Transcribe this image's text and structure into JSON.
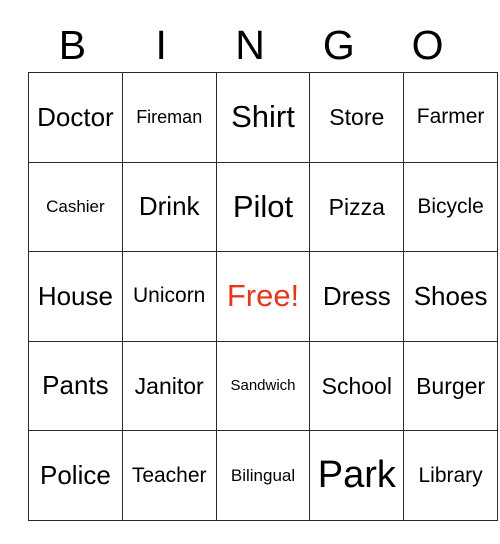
{
  "card": {
    "header_letters": [
      "B",
      "I",
      "N",
      "G",
      "O"
    ],
    "free_color": "#e8361b",
    "text_color": "#000000",
    "border_color": "#2b2b2b",
    "background": "#ffffff",
    "rows": [
      [
        {
          "label": "Doctor",
          "size": "fs-l"
        },
        {
          "label": "Fireman",
          "size": "fs-sm"
        },
        {
          "label": "Shirt",
          "size": "fs-xl"
        },
        {
          "label": "Store",
          "size": "fs-ml"
        },
        {
          "label": "Farmer",
          "size": "fs-m"
        }
      ],
      [
        {
          "label": "Cashier",
          "size": "fs-s"
        },
        {
          "label": "Drink",
          "size": "fs-l"
        },
        {
          "label": "Pilot",
          "size": "fs-xl"
        },
        {
          "label": "Pizza",
          "size": "fs-ml"
        },
        {
          "label": "Bicycle",
          "size": "fs-m"
        }
      ],
      [
        {
          "label": "House",
          "size": "fs-l"
        },
        {
          "label": "Unicorn",
          "size": "fs-m"
        },
        {
          "label": "Free!",
          "size": "free-cell",
          "free": true
        },
        {
          "label": "Dress",
          "size": "fs-l"
        },
        {
          "label": "Shoes",
          "size": "fs-l"
        }
      ],
      [
        {
          "label": "Pants",
          "size": "fs-l"
        },
        {
          "label": "Janitor",
          "size": "fs-ml"
        },
        {
          "label": "Sandwich",
          "size": "fs-xs"
        },
        {
          "label": "School",
          "size": "fs-ml"
        },
        {
          "label": "Burger",
          "size": "fs-ml"
        }
      ],
      [
        {
          "label": "Police",
          "size": "fs-l"
        },
        {
          "label": "Teacher",
          "size": "fs-m"
        },
        {
          "label": "Bilingual",
          "size": "fs-s"
        },
        {
          "label": "Park",
          "size": "fs-xxl"
        },
        {
          "label": "Library",
          "size": "fs-m"
        }
      ]
    ]
  }
}
